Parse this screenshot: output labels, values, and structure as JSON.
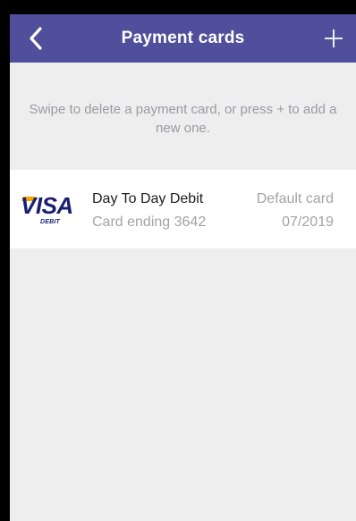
{
  "nav": {
    "title": "Payment cards",
    "back_icon": "chevron-left-icon",
    "add_icon": "plus-icon",
    "bar_color": "#4f4f9b"
  },
  "hint": {
    "text": "Swipe to delete a payment card, or press + to add a new one."
  },
  "cards": [
    {
      "logo_word": "VISA",
      "logo_sub": "DEBIT",
      "name": "Day To Day Debit",
      "ending": "Card ending 3642",
      "status": "Default card",
      "expiry": "07/2019"
    }
  ]
}
